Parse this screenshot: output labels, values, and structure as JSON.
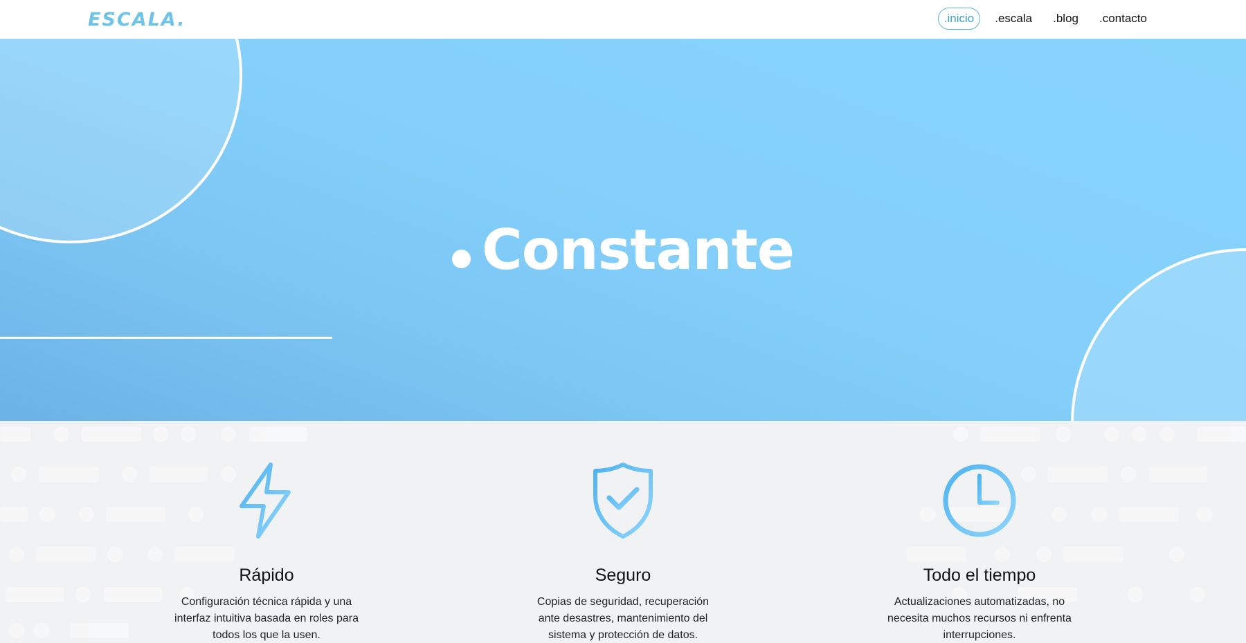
{
  "brand": {
    "logo_text": "ESCALA."
  },
  "nav": {
    "items": [
      {
        "label": ".inicio",
        "active": true
      },
      {
        "label": ".escala",
        "active": false
      },
      {
        "label": ".blog",
        "active": false
      },
      {
        "label": ".contacto",
        "active": false
      }
    ]
  },
  "hero": {
    "title": "Constante"
  },
  "features": [
    {
      "icon": "lightning-icon",
      "title": "Rápido",
      "text": "Configuración técnica rápida y una interfaz intuitiva basada en roles para todos los que la usen."
    },
    {
      "icon": "shield-check-icon",
      "title": "Seguro",
      "text": "Copias de seguridad, recuperación ante desastres, mantenimiento del sistema y protección de datos."
    },
    {
      "icon": "clock-icon",
      "title": "Todo el tiempo",
      "text": "Actualizaciones automatizadas, no necesita muchos recursos ni enfrenta interrupciones."
    }
  ],
  "colors": {
    "accent": "#5bbcf0",
    "hero_bg": "#84d0fb",
    "section_bg": "#f1f2f4"
  }
}
